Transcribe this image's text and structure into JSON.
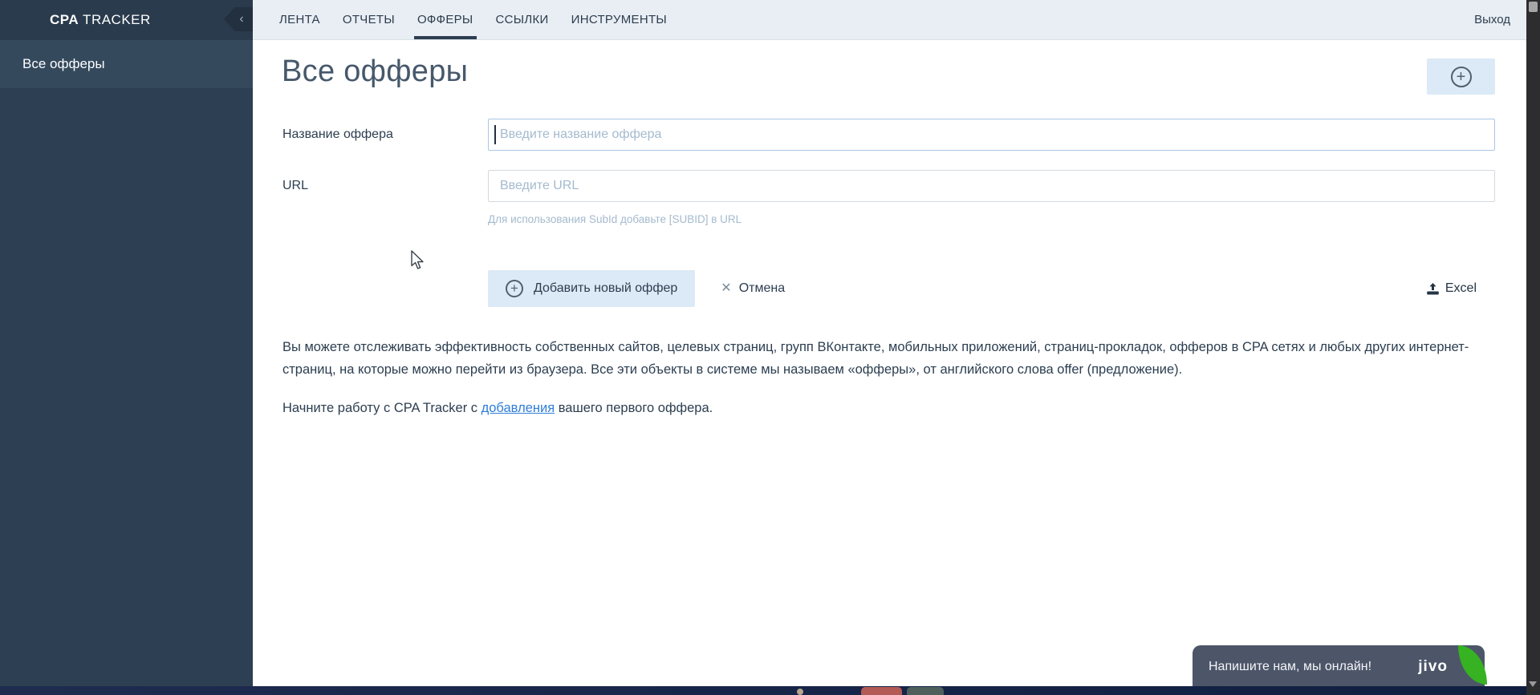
{
  "topbar": {
    "tabs": [
      {
        "label": "ЛЕНТА",
        "active": false
      },
      {
        "label": "ОТЧЕТЫ",
        "active": false
      },
      {
        "label": "ОФФЕРЫ",
        "active": true
      },
      {
        "label": "ССЫЛКИ",
        "active": false
      },
      {
        "label": "ИНСТРУМЕНТЫ",
        "active": false
      }
    ],
    "logout_label": "Выход"
  },
  "sidebar": {
    "brand_bold": "CPA",
    "brand_rest": " TRACKER",
    "items": [
      {
        "label": "Все офферы",
        "active": true
      }
    ]
  },
  "page": {
    "title": "Все офферы"
  },
  "form": {
    "name_label": "Название оффера",
    "name_value": "",
    "name_placeholder": "Введите название оффера",
    "url_label": "URL",
    "url_value": "",
    "url_placeholder": "Введите URL",
    "url_hint": "Для использования SubId добавьте [SUBID] в URL",
    "submit_label": "Добавить новый оффер",
    "cancel_label": "Отмена",
    "excel_label": "Excel"
  },
  "intro": {
    "paragraph": "Вы можете отслеживать эффективность собственных сайтов, целевых страниц, групп ВКонтакте, мобильных приложений, страниц-прокладок, офферов в CPA сетях и любых других интернет-страниц, на которые можно перейти из браузера. Все эти объекты в системе мы называем «офферы», от английского слова offer (предложение).",
    "start_before": "Начните работу с CPA Tracker с ",
    "start_link": "добавления",
    "start_after": " вашего первого оффера."
  },
  "chat": {
    "message": "Напишите нам, мы онлайн!",
    "brand": "jivo"
  },
  "icons": {
    "plus": "+",
    "close": "✕",
    "collapse": "‹",
    "upload": "tray-arrow-up"
  },
  "colors": {
    "sidebar_bg": "#2d3f52",
    "sidebar_header_bg": "#2a3b4d",
    "sidebar_active_bg": "#35495d",
    "topbar_bg": "#e9eef4",
    "text_dark": "#2d3e50",
    "heading": "#46586b",
    "button_bg": "#dce9f6",
    "placeholder": "#a4bace",
    "focus_border": "#a9c7e6",
    "link": "#2f7ed8",
    "jivo_bg": "#4d5669",
    "jivo_green": "#36b222",
    "scrollbar_track": "#2d2d30",
    "taskbar_bg": "#17264a"
  }
}
